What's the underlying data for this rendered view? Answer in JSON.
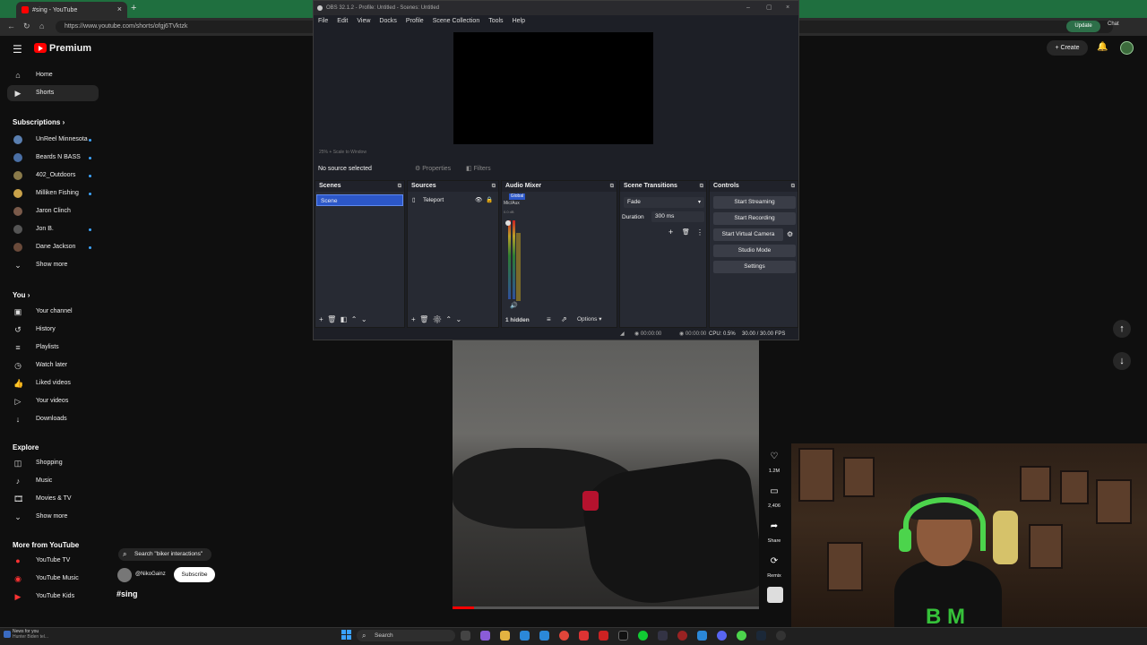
{
  "browser": {
    "tab_title": "#sing - YouTube",
    "new_tab": "+",
    "url": "https://www.youtube.com/shorts/ofgj6TVktzk",
    "update_label": "Update",
    "chat_label": "Chat"
  },
  "youtube": {
    "brand": "Premium",
    "create_label": "Create",
    "sidebar": {
      "top": [
        {
          "label": "Home",
          "icon": "home-icon"
        },
        {
          "label": "Shorts",
          "icon": "shorts-icon"
        }
      ],
      "subscriptions_heading": "Subscriptions",
      "subscriptions": [
        {
          "label": "UnReel Minnesota",
          "color": "#5a7fb0"
        },
        {
          "label": "Beards N BASS",
          "color": "#4a6fa5"
        },
        {
          "label": "402_Outdoors",
          "color": "#8a7a4a"
        },
        {
          "label": "Milliken Fishing",
          "color": "#c9a24a"
        },
        {
          "label": "Jaron Clinch",
          "color": "#7a5a4a"
        },
        {
          "label": "Jon B.",
          "color": "#555555"
        },
        {
          "label": "Dane Jackson",
          "color": "#6a4a3a"
        }
      ],
      "show_more_1": "Show more",
      "you_heading": "You",
      "you": [
        {
          "label": "Your channel"
        },
        {
          "label": "History"
        },
        {
          "label": "Playlists"
        },
        {
          "label": "Watch later"
        },
        {
          "label": "Liked videos"
        },
        {
          "label": "Your videos"
        },
        {
          "label": "Downloads"
        }
      ],
      "explore_heading": "Explore",
      "explore": [
        {
          "label": "Shopping"
        },
        {
          "label": "Music"
        },
        {
          "label": "Movies & TV"
        }
      ],
      "show_more_2": "Show more",
      "more_heading": "More from YouTube",
      "more": [
        {
          "label": "YouTube TV"
        },
        {
          "label": "YouTube Music"
        },
        {
          "label": "YouTube Kids"
        }
      ]
    },
    "short": {
      "search_chip": "Search \"biker interactions\"",
      "channel": "@NikoGainz",
      "subscribe": "Subscribe",
      "hashtag": "#sing",
      "likes": "1.2M",
      "comments": "2,406",
      "share": "Share",
      "remix": "Remix",
      "progress": 0.07
    }
  },
  "obs": {
    "title": "OBS 32.1.2 - Profile: Untitled - Scenes: Untitled",
    "menu": [
      "File",
      "Edit",
      "View",
      "Docks",
      "Profile",
      "Scene Collection",
      "Tools",
      "Help"
    ],
    "zoom": "25%   +   Scale to Window",
    "no_source": "No source selected",
    "properties": "Properties",
    "filters": "Filters",
    "scenes_title": "Scenes",
    "scene_item": "Scene",
    "sources_title": "Sources",
    "source_item": "Teleport",
    "mixer_title": "Audio Mixer",
    "mixer_global": "Global",
    "mixer_channel": "Mic/Aux",
    "mixer_db": "0.0 dB",
    "mixer_hidden": "1 hidden",
    "mixer_options": "Options",
    "transitions_title": "Scene Transitions",
    "transition_value": "Fade",
    "duration_label": "Duration",
    "duration_value": "300 ms",
    "controls_title": "Controls",
    "controls": [
      "Start Streaming",
      "Start Recording",
      "Start Virtual Camera",
      "Studio Mode",
      "Settings"
    ],
    "status_time1": "00:00:00",
    "status_time2": "00:00:00",
    "status_cpu": "CPU: 0.5%",
    "status_fps": "30.00 / 30.00 FPS"
  },
  "taskbar": {
    "news_title": "News for you",
    "news_sub": "Hunter Biden tel...",
    "search": "Search"
  }
}
